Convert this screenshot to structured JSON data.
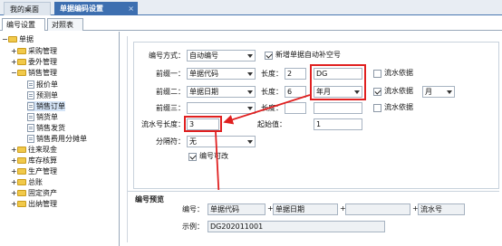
{
  "top_tabs": {
    "home": "我的桌面",
    "active": "单据编码设置",
    "close": "×"
  },
  "sub_tabs": {
    "settings": "编号设置",
    "compare": "对照表"
  },
  "tree": {
    "root": "单据",
    "items": [
      "采购管理",
      "委外管理",
      "销售管理",
      "报价单",
      "预测单",
      "销售订单",
      "销货单",
      "销售发货",
      "销售费用分摊单",
      "往来现金",
      "库存核算",
      "生产管理",
      "总账",
      "固定资产",
      "出纳管理"
    ],
    "selected": "销售订单"
  },
  "form": {
    "mode_label": "编号方式：",
    "mode_value": "自动编号",
    "auto_fill_label": "新增单据自动补空号",
    "prefix1_label": "前缀一：",
    "prefix1_value": "单据代码",
    "length1_label": "长度：",
    "length1_value": "2",
    "code_value": "DG",
    "serial1_label": "流水依据",
    "prefix2_label": "前缀二：",
    "prefix2_value": "单据日期",
    "length2_label": "长度：",
    "length2_value": "6",
    "date_fmt_value": "年月",
    "serial2_label": "流水依据",
    "serial2_value": "月",
    "prefix3_label": "前缀三：",
    "length3_label": "长度：",
    "serial3_label": "流水依据",
    "serial_length_label": "流水号长度：",
    "serial_length_value": "3",
    "start_label": "起始值：",
    "start_value": "1",
    "separator_label": "分隔符：",
    "separator_value": "无",
    "editable_label": "编号可改"
  },
  "preview": {
    "legend": "编号预览",
    "code_label": "编号：",
    "part1": "单据代码",
    "plus": "+",
    "part2": "单据日期",
    "part4": "流水号",
    "example_label": "示例：",
    "example_value": "DG202011001"
  },
  "colors": {
    "accent": "#3d6fb0",
    "highlight": "#e02020"
  }
}
